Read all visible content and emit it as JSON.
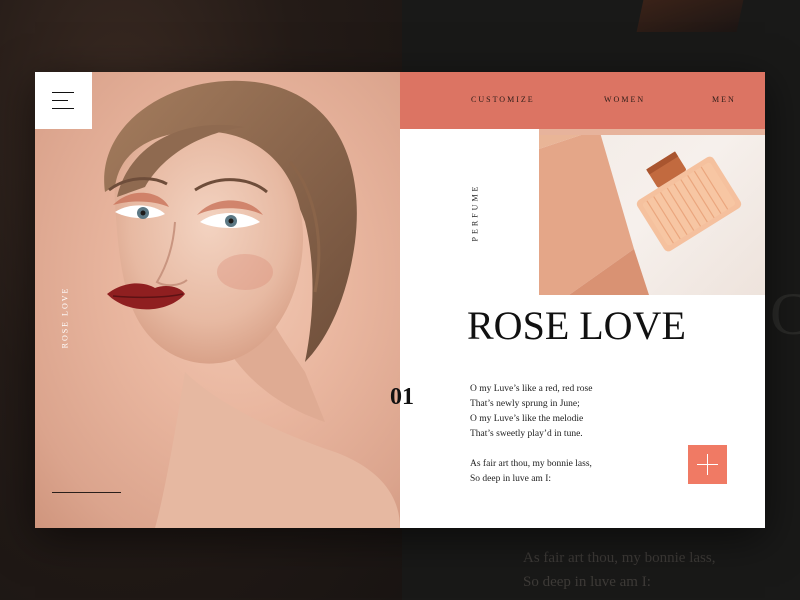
{
  "nav": {
    "items": [
      "CUSTOMIZE",
      "WOMEN",
      "MEN"
    ]
  },
  "hero": {
    "side_label": "ROSE LOVE",
    "category": "PERFUME",
    "title": "ROSE LOVE",
    "number": "01",
    "poem": [
      "O my Luve’s like a red, red rose",
      "That’s newly sprung in June;",
      "O my Luve’s like the melodie",
      "That’s sweetly play’d in tune.",
      "",
      "As fair art thou, my bonnie lass,",
      "So deep in luve am I:"
    ]
  },
  "background": {
    "poem": [
      "As fair art thou, my bonnie lass,",
      "So deep in luve am I:"
    ],
    "big_letter": "C"
  },
  "icons": {
    "menu": "hamburger-menu-icon",
    "add": "plus-icon"
  },
  "colors": {
    "nav_bg": "#dc7463",
    "accent": "#f07a64",
    "card_bg": "#ffffff",
    "backdrop": "#1c1917"
  }
}
